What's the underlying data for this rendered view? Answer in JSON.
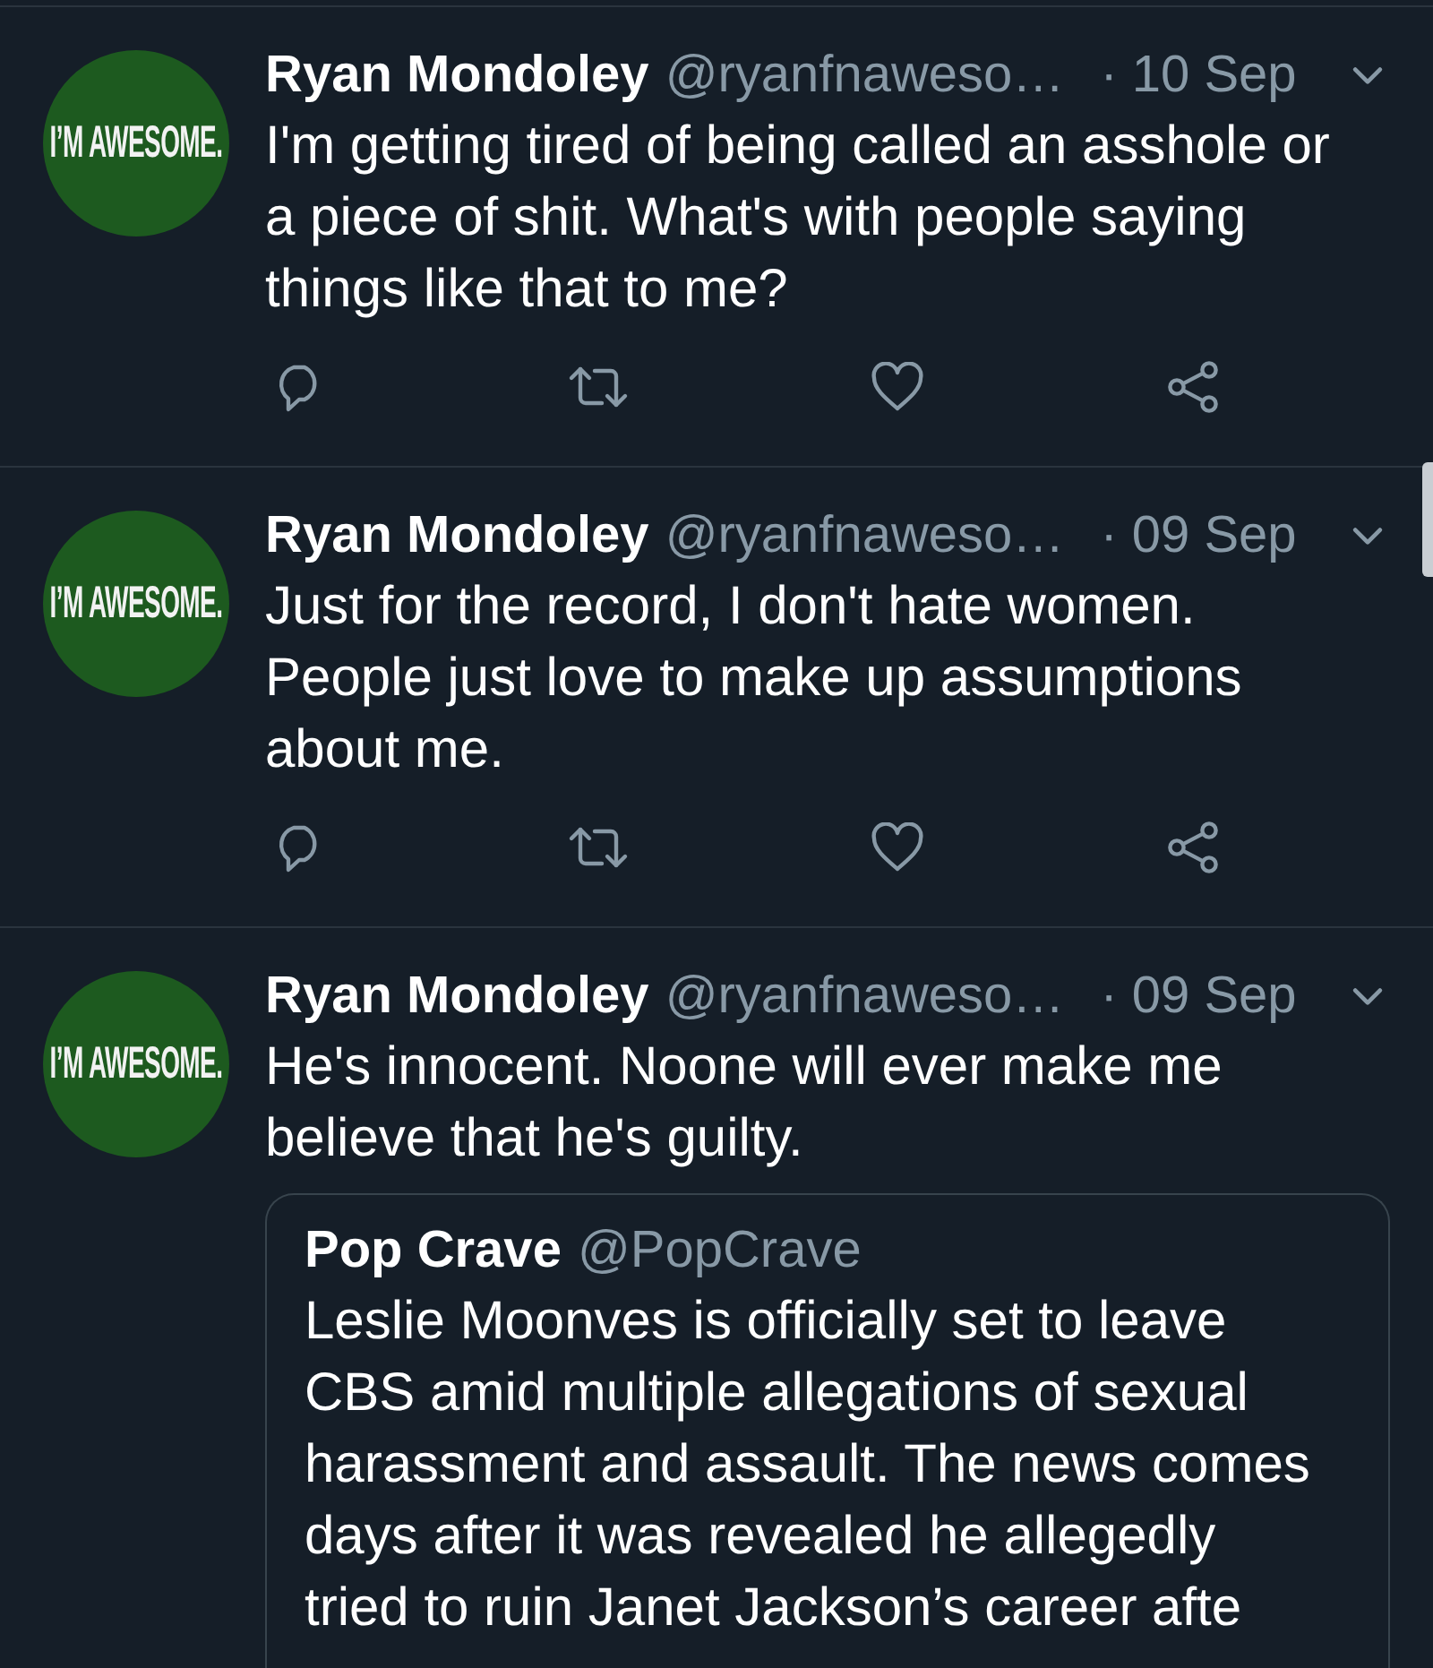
{
  "tweets": [
    {
      "author": {
        "name": "Ryan Mondoley",
        "handle": "@ryanfnaweso…",
        "avatar_caption": "I’M AWESOME."
      },
      "time": "· 10 Sep",
      "text": "I'm getting tired of being called an asshole or a piece of shit. What's with people saying things like that to me?"
    },
    {
      "author": {
        "name": "Ryan Mondoley",
        "handle": "@ryanfnaweso…",
        "avatar_caption": "I’M AWESOME."
      },
      "time": "· 09 Sep",
      "text": "Just for the record, I don't hate women. People just love to make up assumptions about me."
    },
    {
      "author": {
        "name": "Ryan Mondoley",
        "handle": "@ryanfnaweso…",
        "avatar_caption": "I’M AWESOME."
      },
      "time": "· 09 Sep",
      "text": "He's innocent. Noone will ever make me believe that he's guilty.",
      "quoted": {
        "name": "Pop Crave",
        "handle": "@PopCrave",
        "text": "Leslie Moonves is officially set to leave CBS amid multiple allegations of sexual harassment and assault. The news comes days after it was revealed he allegedly tried to ruin Janet Jackson’s career afte"
      }
    }
  ]
}
